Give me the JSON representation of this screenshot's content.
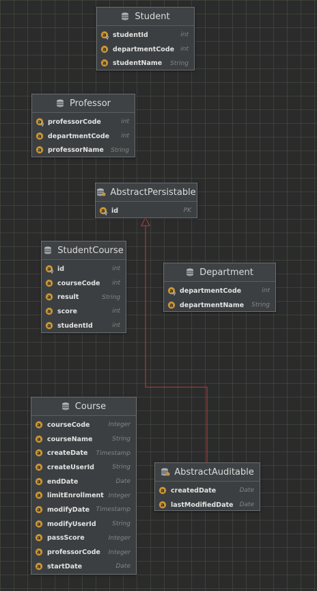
{
  "entities": {
    "student": {
      "title": "Student",
      "fields": [
        {
          "name": "studentId",
          "type": "int",
          "key": true
        },
        {
          "name": "departmentCode",
          "type": "int",
          "key": false
        },
        {
          "name": "studentName",
          "type": "String",
          "key": false
        }
      ]
    },
    "professor": {
      "title": "Professor",
      "fields": [
        {
          "name": "professorCode",
          "type": "int",
          "key": true
        },
        {
          "name": "departmentCode",
          "type": "int",
          "key": false
        },
        {
          "name": "professorName",
          "type": "String",
          "key": false
        }
      ]
    },
    "abstract_persistable": {
      "title": "AbstractPersistable",
      "fields": [
        {
          "name": "id",
          "type": "PK",
          "key": true
        }
      ]
    },
    "student_course": {
      "title": "StudentCourse",
      "fields": [
        {
          "name": "id",
          "type": "int",
          "key": true
        },
        {
          "name": "courseCode",
          "type": "int",
          "key": false
        },
        {
          "name": "result",
          "type": "String",
          "key": false
        },
        {
          "name": "score",
          "type": "int",
          "key": false
        },
        {
          "name": "studentId",
          "type": "int",
          "key": false
        }
      ]
    },
    "department": {
      "title": "Department",
      "fields": [
        {
          "name": "departmentCode",
          "type": "int",
          "key": true
        },
        {
          "name": "departmentName",
          "type": "String",
          "key": false
        }
      ]
    },
    "course": {
      "title": "Course",
      "fields": [
        {
          "name": "courseCode",
          "type": "Integer",
          "key": false
        },
        {
          "name": "courseName",
          "type": "String",
          "key": false
        },
        {
          "name": "createDate",
          "type": "Timestamp",
          "key": false
        },
        {
          "name": "createUserId",
          "type": "String",
          "key": false
        },
        {
          "name": "endDate",
          "type": "Date",
          "key": false
        },
        {
          "name": "limitEnrollment",
          "type": "Integer",
          "key": false
        },
        {
          "name": "modifyDate",
          "type": "Timestamp",
          "key": false
        },
        {
          "name": "modifyUserId",
          "type": "String",
          "key": false
        },
        {
          "name": "passScore",
          "type": "Integer",
          "key": false
        },
        {
          "name": "professorCode",
          "type": "Integer",
          "key": false
        },
        {
          "name": "startDate",
          "type": "Date",
          "key": false
        }
      ]
    },
    "abstract_auditable": {
      "title": "AbstractAuditable",
      "fields": [
        {
          "name": "createdDate",
          "type": "Date",
          "key": false
        },
        {
          "name": "lastModifiedDate",
          "type": "Date",
          "key": false
        }
      ]
    }
  },
  "colors": {
    "field_icon": "#c99535",
    "key_icon": "#c0c0c0",
    "connector": "#b5423f"
  }
}
